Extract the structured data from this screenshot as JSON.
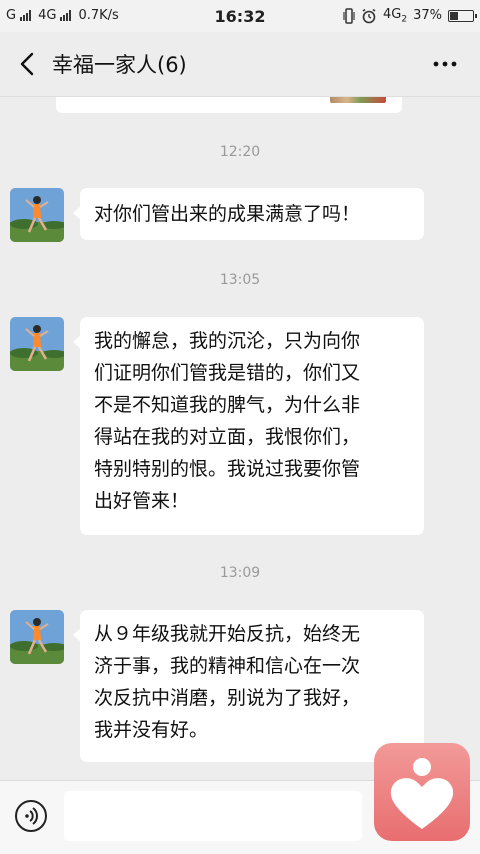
{
  "status": {
    "carrier1": "G",
    "carrier2": "4G",
    "speed": "0.7K/s",
    "time": "16:32",
    "network": "4G",
    "network_sub": "2",
    "battery_pct": "37%",
    "battery_level": 0.37
  },
  "header": {
    "title": "幸福一家人(6)"
  },
  "messages": [
    {
      "time": "12:20",
      "text": "对你们管出来的成果满意了吗！"
    },
    {
      "time": "13:05",
      "text": "我的懈怠，我的沉沦，只为向你\n们证明你们管我是错的，你们又\n不是不知道我的脾气，为什么非\n得站在我的对立面，我恨你们，\n特别特别的恨。我说过我要你管\n出好管来！"
    },
    {
      "time": "13:09",
      "text": "从９年级我就开始反抗，始终无\n济于事，我的精神和信心在一次\n次反抗中消磨，别说为了我好，\n我并没有好。"
    }
  ],
  "icons": {
    "back": "chevron-left-icon",
    "more": "more-dots-icon",
    "voice": "voice-icon",
    "floating": "heart-app-icon"
  },
  "colors": {
    "background": "#ededed",
    "bubble": "#ffffff",
    "floating_app": "#e86e70"
  }
}
